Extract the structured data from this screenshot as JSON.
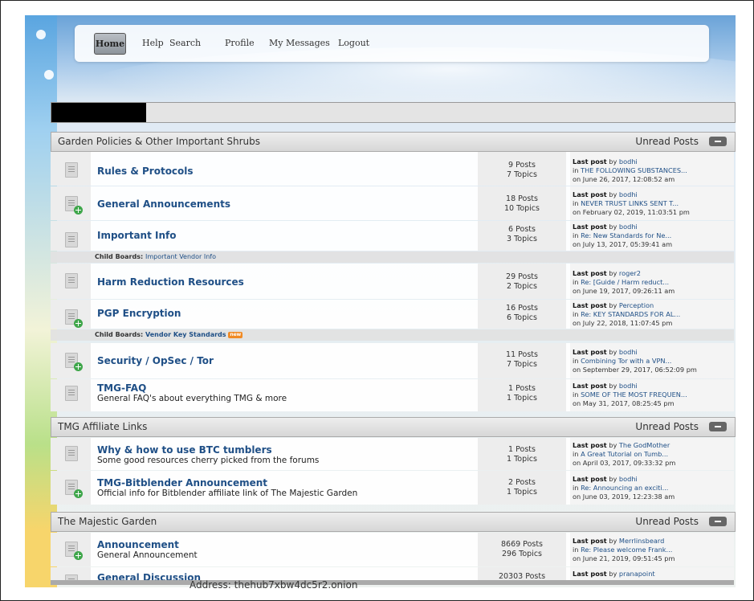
{
  "nav": {
    "home": "Home",
    "items": [
      "Help",
      "Search",
      "Profile",
      "My Messages",
      "Logout"
    ]
  },
  "categories": [
    {
      "title": "Garden Policies & Other Important Shrubs",
      "unread": "Unread Posts",
      "boards": [
        {
          "name": "Rules & Protocols",
          "desc": "",
          "posts": "9 Posts",
          "topics": "7 Topics",
          "by": "bodhi",
          "in": "THE FOLLOWING SUBSTANCES...",
          "on": "on June 26, 2017, 12:08:52 am",
          "new": false
        },
        {
          "name": "General Announcements",
          "desc": "",
          "posts": "18 Posts",
          "topics": "10 Topics",
          "by": "bodhi",
          "in": "NEVER TRUST LINKS SENT T...",
          "on": "on February 02, 2019, 11:03:51 pm",
          "new": true
        },
        {
          "name": "Important Info",
          "desc": "",
          "posts": "6 Posts",
          "topics": "3 Topics",
          "by": "bodhi",
          "in": "Re: New Standards for Ne...",
          "on": "on July 13, 2017, 05:39:41 am",
          "new": false,
          "child": {
            "label": "Child Boards",
            "value": "Important Vendor Info",
            "isNew": false
          }
        },
        {
          "name": "Harm Reduction Resources",
          "desc": "",
          "posts": "29 Posts",
          "topics": "2 Topics",
          "by": "roger2",
          "in": "Re: [Guide / Harm reduct...",
          "on": "on June 19, 2017, 09:26:11 am",
          "new": false
        },
        {
          "name": "PGP Encryption",
          "desc": "",
          "posts": "16 Posts",
          "topics": "6 Topics",
          "by": "Perception",
          "in": "Re: KEY STANDARDS FOR AL...",
          "on": "on July 22, 2018, 11:07:45 pm",
          "new": true,
          "child": {
            "label": "Child Boards",
            "value": "Vendor Key Standards",
            "isNew": true,
            "badge": "new"
          }
        },
        {
          "name": "Security / OpSec / Tor",
          "desc": "",
          "posts": "11 Posts",
          "topics": "7 Topics",
          "by": "bodhi",
          "in": "Combining Tor with a VPN...",
          "on": "on September 29, 2017, 06:52:09 pm",
          "new": true
        },
        {
          "name": "TMG-FAQ",
          "desc": "General FAQ's about everything TMG & more",
          "posts": "1 Posts",
          "topics": "1 Topics",
          "by": "bodhi",
          "in": "SOME OF THE MOST FREQUEN...",
          "on": "on May 31, 2017, 08:25:45 pm",
          "new": false
        }
      ]
    },
    {
      "title": "TMG Affiliate Links",
      "unread": "Unread Posts",
      "boards": [
        {
          "name": "Why & how to use BTC tumblers",
          "desc": "Some good resources cherry picked from the forums",
          "posts": "1 Posts",
          "topics": "1 Topics",
          "by": "The GodMother",
          "in": "A Great Tutorial on Tumb...",
          "on": "on April 03, 2017, 09:33:32 pm",
          "new": false
        },
        {
          "name": "TMG-Bitblender Announcement",
          "desc": "Official info for Bitblender affiliate link of The Majestic Garden",
          "posts": "2 Posts",
          "topics": "1 Topics",
          "by": "bodhi",
          "in": "Re: Announcing an exciti...",
          "on": "on June 03, 2019, 12:23:38 am",
          "new": true
        }
      ]
    },
    {
      "title": "The Majestic Garden",
      "unread": "Unread Posts",
      "boards": [
        {
          "name": "Announcement",
          "desc": "General Announcement",
          "posts": "8669 Posts",
          "topics": "296 Topics",
          "by": "Merrlinsbeard",
          "in": "Re: Please welcome Frank...",
          "on": "on June 21, 2019, 09:51:45 pm",
          "new": true
        },
        {
          "name": "General Discussion",
          "desc": "",
          "posts": "20303 Posts",
          "topics": "",
          "by": "pranapoint",
          "in": "",
          "on": "",
          "new": false
        }
      ]
    }
  ],
  "labels": {
    "last_post": "Last post",
    "by": "by",
    "in": "in"
  },
  "address": "Address: thehub7xbw4dc5r2.onion"
}
